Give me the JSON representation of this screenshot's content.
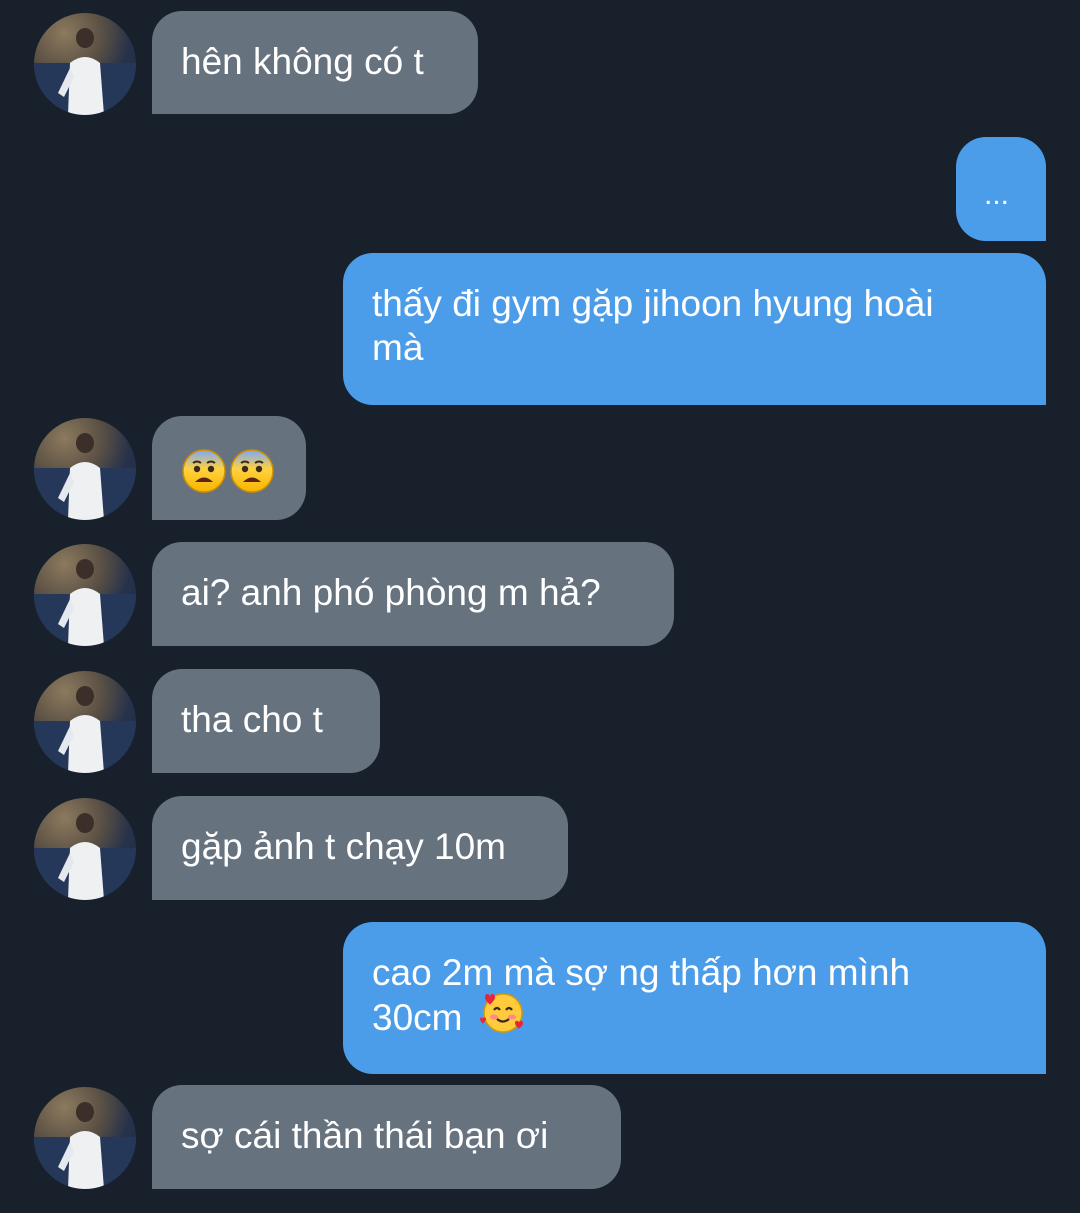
{
  "messages": [
    {
      "side": "in",
      "text": "hên không có t"
    },
    {
      "side": "out",
      "text": "..."
    },
    {
      "side": "out",
      "text": "thấy đi gym gặp jihoon hyung hoài mà"
    },
    {
      "side": "in",
      "emoji": [
        "anxious-face-icon",
        "anxious-face-icon"
      ]
    },
    {
      "side": "in",
      "text": "ai? anh phó phòng m hả?"
    },
    {
      "side": "in",
      "text": "tha cho t"
    },
    {
      "side": "in",
      "text": "gặp ảnh t chạy 10m"
    },
    {
      "side": "out",
      "text_line1": "cao 2m mà sợ ng thấp hơn mình",
      "text_line2": "30cm",
      "emoji": "smiling-face-with-hearts-icon"
    },
    {
      "side": "in",
      "text": "sợ cái thần thái bạn ơi"
    }
  ],
  "colors": {
    "background": "#17202b",
    "incoming_bubble": "#67727f",
    "outgoing_bubble": "#4c9de9",
    "text": "#ffffff"
  }
}
